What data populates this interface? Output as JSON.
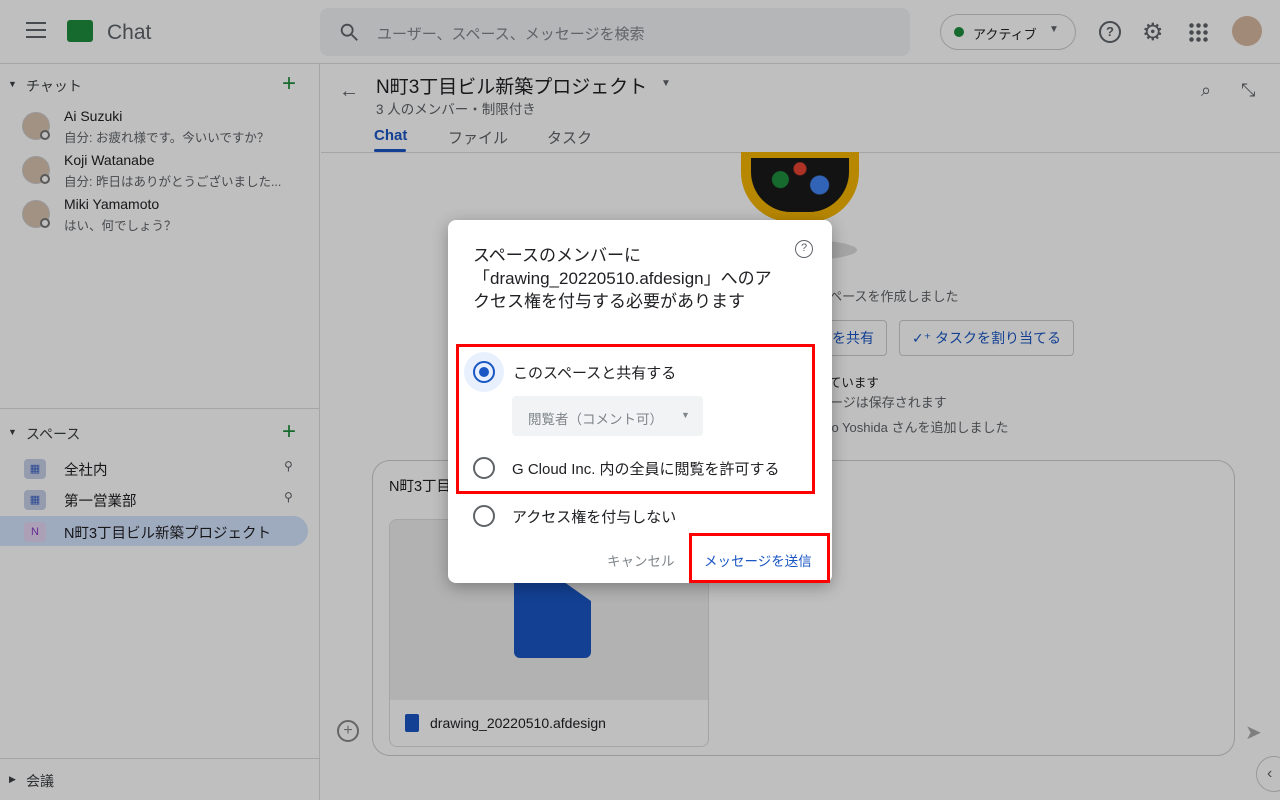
{
  "app": {
    "title": "Chat",
    "search_placeholder": "ユーザー、スペース、メッセージを検索",
    "status": "アクティブ",
    "brand_color": "#1e8e3e"
  },
  "sidebar": {
    "chat_section": "チャット",
    "dms": [
      {
        "name": "Ai Suzuki",
        "preview": "自分: お疲れ様です。今いいですか？"
      },
      {
        "name": "Koji Watanabe",
        "preview": "自分: 昨日はありがとうございました..."
      },
      {
        "name": "Miki Yamamoto",
        "preview": "はい、何でしょう？"
      }
    ],
    "spaces_section": "スペース",
    "spaces": [
      {
        "label": "全社内",
        "icon": "space-icon"
      },
      {
        "label": "第一営業部",
        "icon": "space-icon"
      },
      {
        "label": "N町3丁目ビル新築プロジェクト",
        "icon": "N"
      }
    ],
    "meetings_section": "会議"
  },
  "main": {
    "title": "N町3丁目ビル新築プロジェクト",
    "subtitle": "3 人のメンバー・制限付き",
    "tabs": [
      {
        "label": "Chat",
        "active": true
      },
      {
        "label": "ファイル"
      },
      {
        "label": "タスク"
      }
    ],
    "bg_texts": [
      "スペースを作成しました",
      "を共有",
      "タスクを割り当てる",
      "っています",
      "セージは保存されます",
      "hiro Yoshida さんを追加しました"
    ],
    "composer_text": "N町3丁目",
    "attachment_name": "drawing_20220510.afdesign"
  },
  "dialog": {
    "title": "スペースのメンバーに「drawing_20220510.afdesign」へのアクセス権を付与する必要があります",
    "options": [
      {
        "label": "このスペースと共有する",
        "selected": true
      },
      {
        "label": "G Cloud Inc. 内の全員に閲覧を許可する",
        "selected": false
      },
      {
        "label": "アクセス権を付与しない",
        "selected": false
      }
    ],
    "permission": "閲覧者（コメント可）",
    "cancel": "キャンセル",
    "send": "メッセージを送信",
    "highlight_color": "#ff0000"
  }
}
